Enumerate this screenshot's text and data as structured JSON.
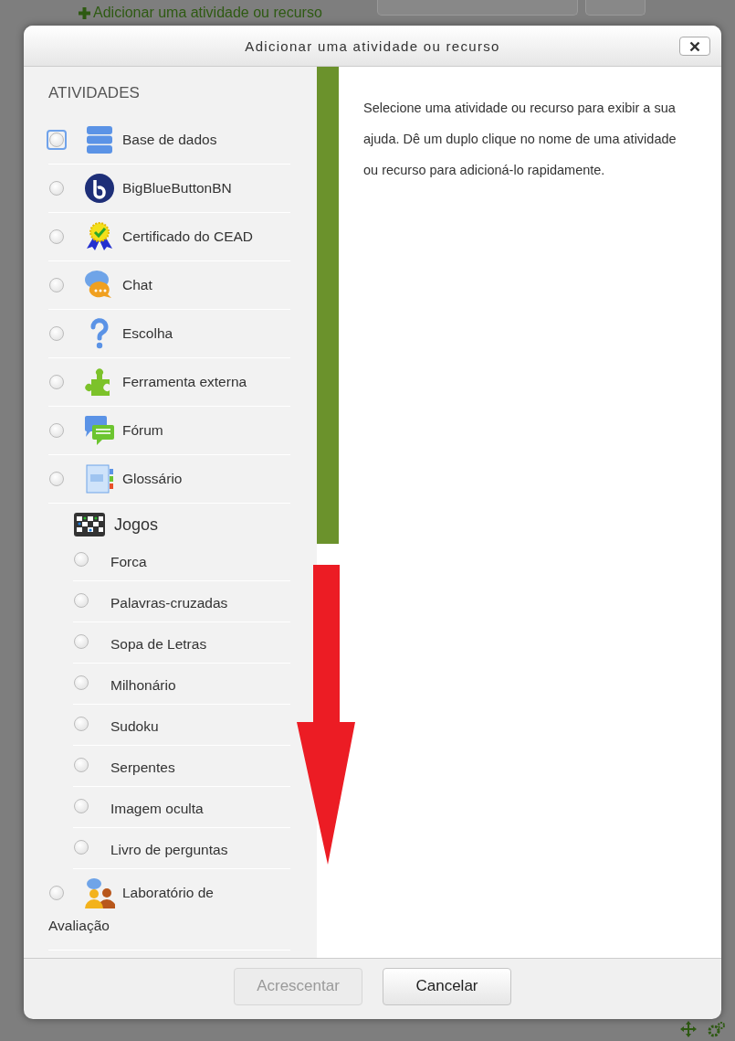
{
  "page": {
    "add_link": "Adicionar uma atividade ou recurso"
  },
  "dialog": {
    "title": "Adicionar uma atividade ou recurso",
    "section_heading": "ATIVIDADES",
    "items": [
      {
        "kind": "module",
        "label": "Base de dados",
        "selected": false,
        "focused": true
      },
      {
        "kind": "module",
        "label": "BigBlueButtonBN",
        "selected": false,
        "focused": false
      },
      {
        "kind": "module",
        "label": "Certificado do CEAD",
        "selected": false,
        "focused": false
      },
      {
        "kind": "module",
        "label": "Chat",
        "selected": false,
        "focused": false
      },
      {
        "kind": "module",
        "label": "Escolha",
        "selected": false,
        "focused": false
      },
      {
        "kind": "module",
        "label": "Ferramenta externa",
        "selected": false,
        "focused": false
      },
      {
        "kind": "module",
        "label": "Fórum",
        "selected": false,
        "focused": false
      },
      {
        "kind": "module",
        "label": "Glossário",
        "selected": false,
        "focused": false
      },
      {
        "kind": "group",
        "label": "Jogos",
        "children": [
          {
            "label": "Forca",
            "selected": false
          },
          {
            "label": "Palavras-cruzadas",
            "selected": false
          },
          {
            "label": "Sopa de Letras",
            "selected": false
          },
          {
            "label": "Milhonário",
            "selected": false
          },
          {
            "label": "Sudoku",
            "selected": false
          },
          {
            "label": "Serpentes",
            "selected": false
          },
          {
            "label": "Imagem oculta",
            "selected": false
          },
          {
            "label": "Livro de perguntas",
            "selected": false
          }
        ]
      },
      {
        "kind": "module",
        "label": "Laboratório de Avaliação",
        "selected": false,
        "focused": false
      }
    ],
    "help_text": "Selecione uma atividade ou recurso para exibir a sua ajuda. Dê um duplo clique no nome de uma atividade ou recurso para adicioná-lo rapidamente.",
    "buttons": [
      {
        "label": "Acrescentar",
        "disabled": true
      },
      {
        "label": "Cancelar",
        "disabled": false
      }
    ]
  }
}
